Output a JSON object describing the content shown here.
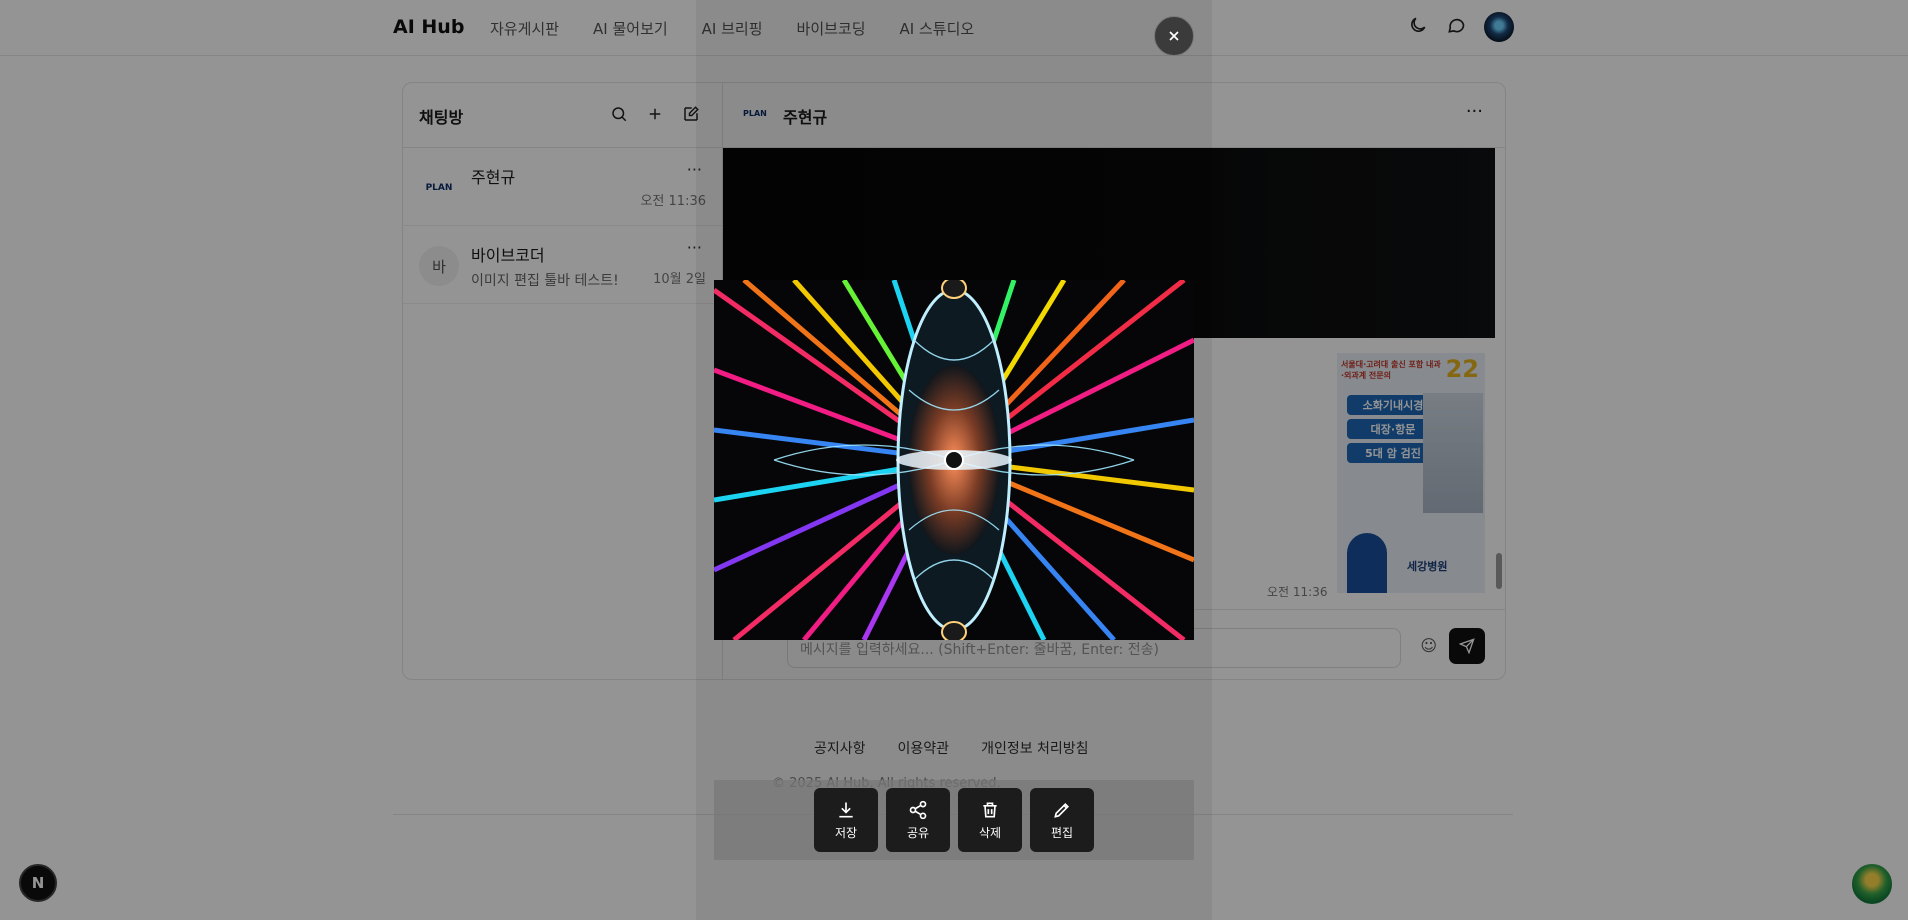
{
  "header": {
    "brand": "AI Hub",
    "nav": [
      "자유게시판",
      "AI 물어보기",
      "AI 브리핑",
      "바이브코딩",
      "AI 스튜디오"
    ],
    "icons": [
      "moon-icon",
      "chat-bubble-icon",
      "user-avatar"
    ]
  },
  "sidebar": {
    "title": "채팅방",
    "actions": [
      "search-icon",
      "plus-icon",
      "compose-icon"
    ],
    "rooms": [
      {
        "avatar": "PLAN",
        "name": "주현규",
        "message": "",
        "time": "오전 11:36"
      },
      {
        "avatar": "바",
        "name": "바이브코더",
        "message": "이미지 편집 툴바 테스트!",
        "time": "10월 2일"
      }
    ]
  },
  "conversation": {
    "logo": "PLAN",
    "name": "주현규",
    "message_time": "오전 11:36",
    "ad": {
      "top": "서울대·고려대 출신 포함 내과·외과계 전문의",
      "big": "22",
      "pills": [
        "소화기내시경",
        "대장·항문",
        "5대 암 검진"
      ],
      "hospital": "세강병원"
    },
    "composer_placeholder": "메시지를 입력하세요... (Shift+Enter: 줄바꿈, Enter: 전송)"
  },
  "footer": {
    "links": [
      "공지사항",
      "이용약관",
      "개인정보 처리방침"
    ],
    "copyright": "© 2025 AI Hub. All rights reserved."
  },
  "bottom_left_badge": "N",
  "viewer": {
    "toolbar": [
      {
        "label": "저장",
        "icon": "download-icon"
      },
      {
        "label": "공유",
        "icon": "share-icon"
      },
      {
        "label": "삭제",
        "icon": "trash-icon"
      },
      {
        "label": "편집",
        "icon": "pencil-icon"
      }
    ]
  }
}
